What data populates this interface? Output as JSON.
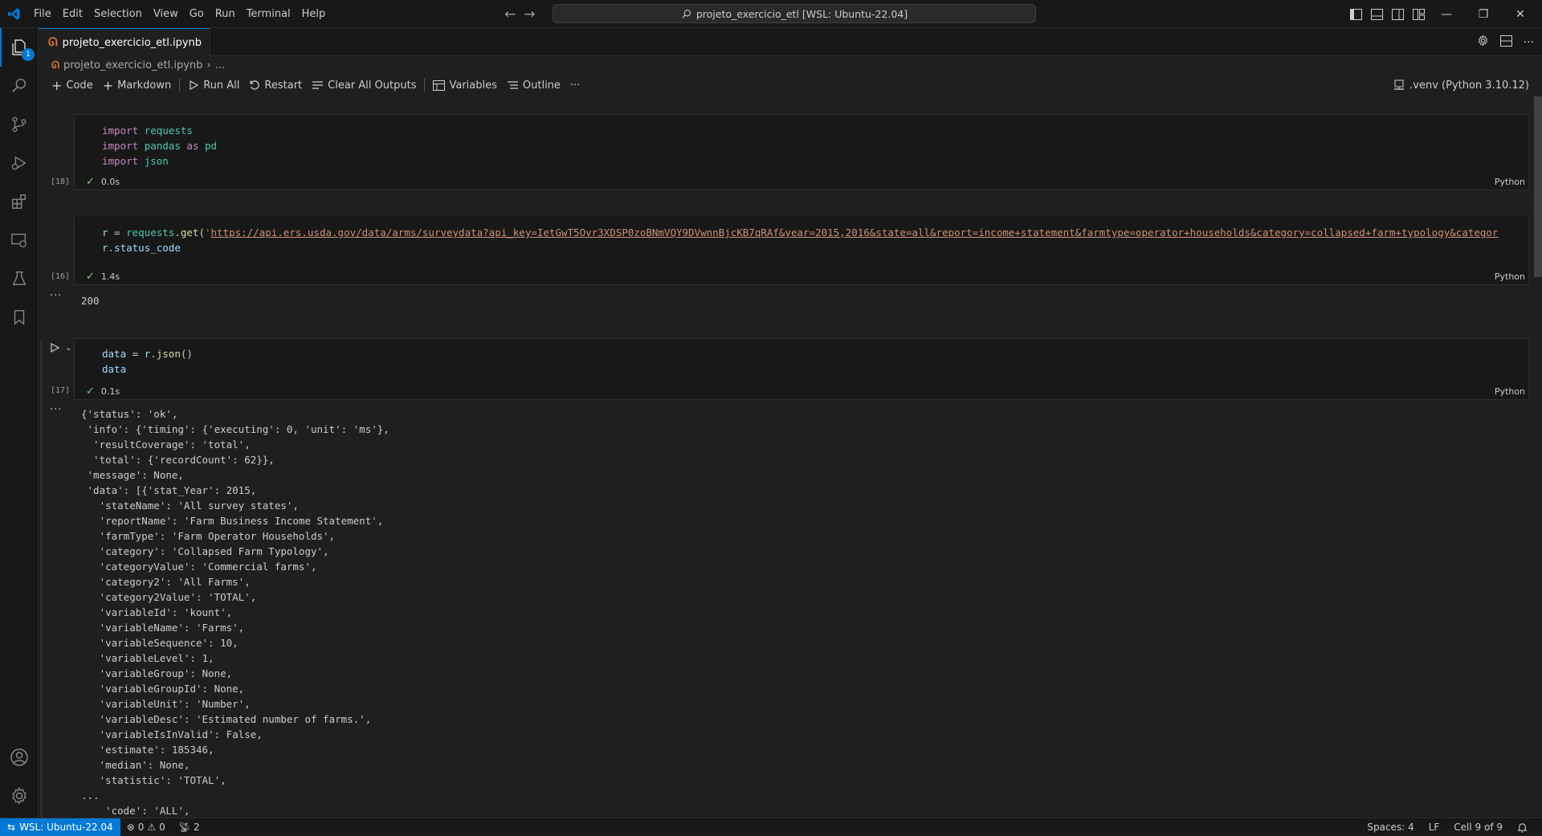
{
  "titlebar": {
    "menu": [
      "File",
      "Edit",
      "Selection",
      "View",
      "Go",
      "Run",
      "Terminal",
      "Help"
    ],
    "command_center": "projeto_exercicio_etl [WSL: Ubuntu-22.04]"
  },
  "activity": {
    "explorer_badge": "1"
  },
  "tab": {
    "title": "projeto_exercicio_etl.ipynb"
  },
  "breadcrumb": {
    "file": "projeto_exercicio_etl.ipynb",
    "rest": "..."
  },
  "toolbar": {
    "code": "Code",
    "markdown": "Markdown",
    "run_all": "Run All",
    "restart": "Restart",
    "clear_outputs": "Clear All Outputs",
    "variables": "Variables",
    "outline": "Outline",
    "more": "···",
    "kernel": ".venv (Python 3.10.12)"
  },
  "cells": [
    {
      "exec_count": "[18]",
      "duration": "0.0s",
      "language": "Python",
      "lines": [
        [
          {
            "t": "import",
            "c": "kw"
          },
          {
            "t": " ",
            "c": "plain"
          },
          {
            "t": "requests",
            "c": "mod"
          }
        ],
        [
          {
            "t": "import",
            "c": "kw"
          },
          {
            "t": " ",
            "c": "plain"
          },
          {
            "t": "pandas",
            "c": "mod"
          },
          {
            "t": " ",
            "c": "plain"
          },
          {
            "t": "as",
            "c": "kw"
          },
          {
            "t": " ",
            "c": "plain"
          },
          {
            "t": "pd",
            "c": "mod"
          }
        ],
        [
          {
            "t": "import",
            "c": "kw"
          },
          {
            "t": " ",
            "c": "plain"
          },
          {
            "t": "json",
            "c": "mod"
          }
        ]
      ]
    },
    {
      "exec_count": "[16]",
      "duration": "1.4s",
      "language": "Python",
      "lines": [
        [
          {
            "t": "r",
            "c": "var"
          },
          {
            "t": " = ",
            "c": "plain"
          },
          {
            "t": "requests",
            "c": "mod"
          },
          {
            "t": ".",
            "c": "plain"
          },
          {
            "t": "get",
            "c": "fn"
          },
          {
            "t": "(",
            "c": "plain"
          },
          {
            "t": "'",
            "c": "str"
          },
          {
            "t": "https://api.ers.usda.gov/data/arms/surveydata?api_key=IetGwT5Ovr3XDSP0zoBNmVQY9DVwnnBjcKB7qRAf&year=2015,2016&state=all&report=income+statement&farmtype=operator+households&category=collapsed+farm+typology&categor",
            "c": "url"
          }
        ],
        [
          {
            "t": "r",
            "c": "var"
          },
          {
            "t": ".",
            "c": "plain"
          },
          {
            "t": "status_code",
            "c": "var"
          }
        ]
      ],
      "output": "200"
    },
    {
      "exec_count": "[17]",
      "duration": "0.1s",
      "language": "Python",
      "lines": [
        [
          {
            "t": "data",
            "c": "var"
          },
          {
            "t": " = ",
            "c": "plain"
          },
          {
            "t": "r",
            "c": "var"
          },
          {
            "t": ".",
            "c": "plain"
          },
          {
            "t": "json",
            "c": "fn"
          },
          {
            "t": "()",
            "c": "plain"
          }
        ],
        [
          {
            "t": "data",
            "c": "var"
          }
        ]
      ],
      "output_lines": [
        "{'status': 'ok',",
        " 'info': {'timing': {'executing': 0, 'unit': 'ms'},",
        "  'resultCoverage': 'total',",
        "  'total': {'recordCount': 62}},",
        " 'message': None,",
        " 'data': [{'stat_Year': 2015,",
        "   'stateName': 'All survey states',",
        "   'reportName': 'Farm Business Income Statement',",
        "   'farmType': 'Farm Operator Households',",
        "   'category': 'Collapsed Farm Typology',",
        "   'categoryValue': 'Commercial farms',",
        "   'category2': 'All Farms',",
        "   'category2Value': 'TOTAL',",
        "   'variableId': 'kount',",
        "   'variableName': 'Farms',",
        "   'variableSequence': 10,",
        "   'variableLevel': 1,",
        "   'variableGroup': None,",
        "   'variableGroupId': None,",
        "   'variableUnit': 'Number',",
        "   'variableDesc': 'Estimated number of farms.',",
        "   'variableIsInValid': False,",
        "   'estimate': 185346,",
        "   'median': None,",
        "   'statistic': 'TOTAL',",
        "...",
        "    'code': 'ALL',"
      ]
    }
  ],
  "statusbar": {
    "remote": "WSL: Ubuntu-22.04",
    "errors": "0",
    "warnings": "0",
    "ports": "2",
    "spaces": "Spaces: 4",
    "eol": "LF",
    "cell": "Cell 9 of 9"
  },
  "colors": {
    "accent": "#0078d4",
    "background": "#1f1f1f",
    "cell_background": "#181818"
  }
}
